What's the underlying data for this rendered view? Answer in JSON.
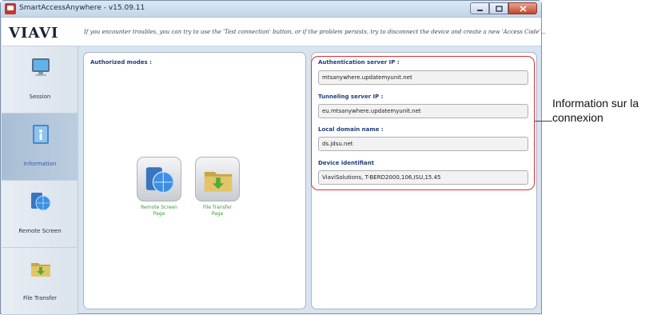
{
  "window": {
    "title": "SmartAccessAnywhere - v15.09.11",
    "controls": [
      "minimize-icon",
      "maximize-icon",
      "close-icon"
    ]
  },
  "header": {
    "logo": "VIAVI",
    "message": "If you encounter troubles, you can try to use the 'Test connection' button, or if the problem persists, try to disconnect the device and create a new 'Access Code'..."
  },
  "sidebar": {
    "items": [
      {
        "label": "Session",
        "icon": "monitor-icon",
        "active": false
      },
      {
        "label": "Information",
        "icon": "information-icon",
        "active": true
      },
      {
        "label": "Remote Screen",
        "icon": "remote-screen-icon",
        "active": false
      },
      {
        "label": "File Transfer",
        "icon": "folder-download-icon",
        "active": false
      }
    ]
  },
  "modes": {
    "title": "Authorized modes :",
    "remote_label_1": "Remote Screen",
    "remote_label_2": "Page",
    "file_label_1": "File Transfer",
    "file_label_2": "Page"
  },
  "info": {
    "auth_label": "Authentication server IP :",
    "auth_value": "mtsanywhere.updatemyunit.net",
    "tunnel_label": "Tunneling server IP :",
    "tunnel_value": "eu.mtsanywhere.updatemyunit.net",
    "domain_label": "Local domain name :",
    "domain_value": "ds.jdsu.net",
    "device_label": "Device identifiant",
    "device_value": "ViaviSolutions, T-BERD2000,106,ISU,15.45"
  },
  "annotation": {
    "line1": "Information sur la",
    "line2": "connexion",
    "color": "#d8323a"
  }
}
